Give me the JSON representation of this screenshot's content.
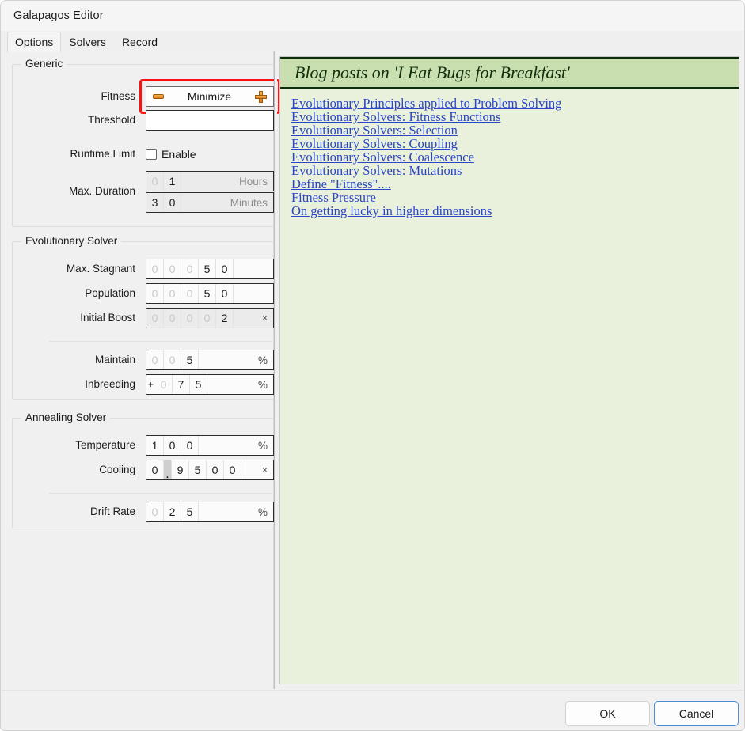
{
  "window": {
    "title": "Galapagos Editor"
  },
  "tabs": [
    {
      "label": "Options",
      "active": true
    },
    {
      "label": "Solvers",
      "active": false
    },
    {
      "label": "Record",
      "active": false
    }
  ],
  "colors": {
    "highlight": "#fc1111",
    "accent_orange": "#e07a16",
    "link": "#2a45c8",
    "panel_green": "#e9f1dc",
    "panel_green_header": "#cadfb0",
    "focus_blue": "#4a8fd4"
  },
  "generic": {
    "title": "Generic",
    "fitness": {
      "label": "Fitness",
      "value": "Minimize",
      "decrement_icon": "minus-icon",
      "increment_icon": "plus-icon",
      "highlighted": true
    },
    "threshold": {
      "label": "Threshold",
      "value": ""
    },
    "runtime_limit": {
      "label": "Runtime Limit",
      "checkbox_label": "Enable",
      "checked": false
    },
    "max_duration": {
      "label": "Max. Duration",
      "hours": {
        "digits": [
          "0",
          "1"
        ],
        "faded": [
          true,
          false
        ],
        "unit": "Hours"
      },
      "minutes": {
        "digits": [
          "3",
          "0"
        ],
        "faded": [
          false,
          false
        ],
        "unit": "Minutes"
      }
    }
  },
  "evolutionary_solver": {
    "title": "Evolutionary Solver",
    "rows": [
      {
        "label": "Max. Stagnant",
        "digits": [
          "0",
          "0",
          "0",
          "5",
          "0"
        ],
        "faded": [
          true,
          true,
          true,
          false,
          false
        ],
        "unit": "",
        "disabled": false
      },
      {
        "label": "Population",
        "digits": [
          "0",
          "0",
          "0",
          "5",
          "0"
        ],
        "faded": [
          true,
          true,
          true,
          false,
          false
        ],
        "unit": "",
        "disabled": false
      },
      {
        "label": "Initial Boost",
        "digits": [
          "0",
          "0",
          "0",
          "0",
          "2"
        ],
        "faded": [
          true,
          true,
          true,
          true,
          false
        ],
        "unit": "×",
        "disabled": true
      },
      {
        "label": "Maintain",
        "digits": [
          "0",
          "0",
          "5"
        ],
        "faded": [
          true,
          true,
          false
        ],
        "unit": "%",
        "disabled": false
      },
      {
        "label": "Inbreeding",
        "sign": "+",
        "digits": [
          "0",
          "7",
          "5"
        ],
        "faded": [
          true,
          false,
          false
        ],
        "unit": "%",
        "disabled": false
      }
    ]
  },
  "annealing_solver": {
    "title": "Annealing Solver",
    "rows": [
      {
        "label": "Temperature",
        "digits": [
          "1",
          "0",
          "0"
        ],
        "faded": [
          false,
          false,
          false
        ],
        "unit": "%",
        "disabled": false
      },
      {
        "label": "Cooling",
        "digits": [
          "0",
          ".",
          "9",
          "5",
          "0",
          "0"
        ],
        "faded": [
          false,
          false,
          false,
          false,
          false,
          false
        ],
        "unit": "×",
        "disabled": false
      },
      {
        "label": "Drift Rate",
        "digits": [
          "0",
          "2",
          "5"
        ],
        "faded": [
          true,
          false,
          false
        ],
        "unit": "%",
        "disabled": false
      }
    ]
  },
  "blog": {
    "header": "Blog posts on 'I Eat Bugs for Breakfast'",
    "links": [
      "Evolutionary Principles applied to Problem Solving",
      "Evolutionary Solvers: Fitness Functions",
      "Evolutionary Solvers: Selection",
      "Evolutionary Solvers: Coupling",
      "Evolutionary Solvers: Coalescence",
      "Evolutionary Solvers: Mutations",
      "Define \"Fitness\"....",
      "Fitness Pressure",
      "On getting lucky in higher dimensions"
    ]
  },
  "footer": {
    "ok_label": "OK",
    "cancel_label": "Cancel"
  }
}
